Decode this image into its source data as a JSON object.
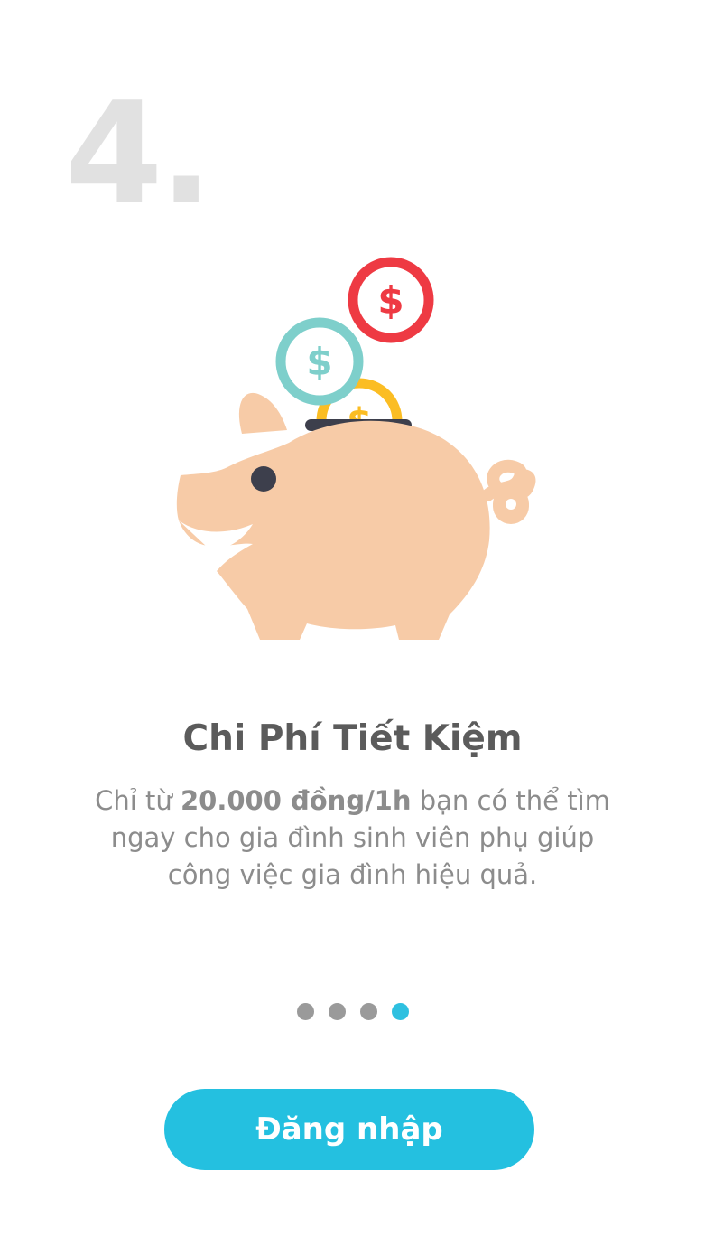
{
  "step": {
    "number": "4."
  },
  "feature": {
    "title": "Chi Phí Tiết Kiệm",
    "description_prefix": "Chỉ từ ",
    "description_highlight": "20.000 đồng/1h",
    "description_suffix": " bạn có thể tìm ngay cho gia đình sinh viên phụ giúp công việc gia đình hiệu quả."
  },
  "illustration": {
    "icon": "piggy-bank-with-coins",
    "coins": [
      {
        "name": "red-dollar-coin",
        "color": "#ee3a43",
        "symbol": "$"
      },
      {
        "name": "teal-dollar-coin",
        "color": "#7ecfcb",
        "symbol": "$"
      },
      {
        "name": "yellow-dollar-coin",
        "color": "#fbbd23",
        "symbol": "$"
      }
    ],
    "pig_color": "#f7cba7",
    "eye_color": "#3d3f4c"
  },
  "pager": {
    "total": 4,
    "active_index": 3,
    "active_color": "#2ec0e0",
    "inactive_color": "#9a9a9a"
  },
  "actions": {
    "login_label": "Đăng nhập",
    "login_color": "#24c0e0"
  }
}
